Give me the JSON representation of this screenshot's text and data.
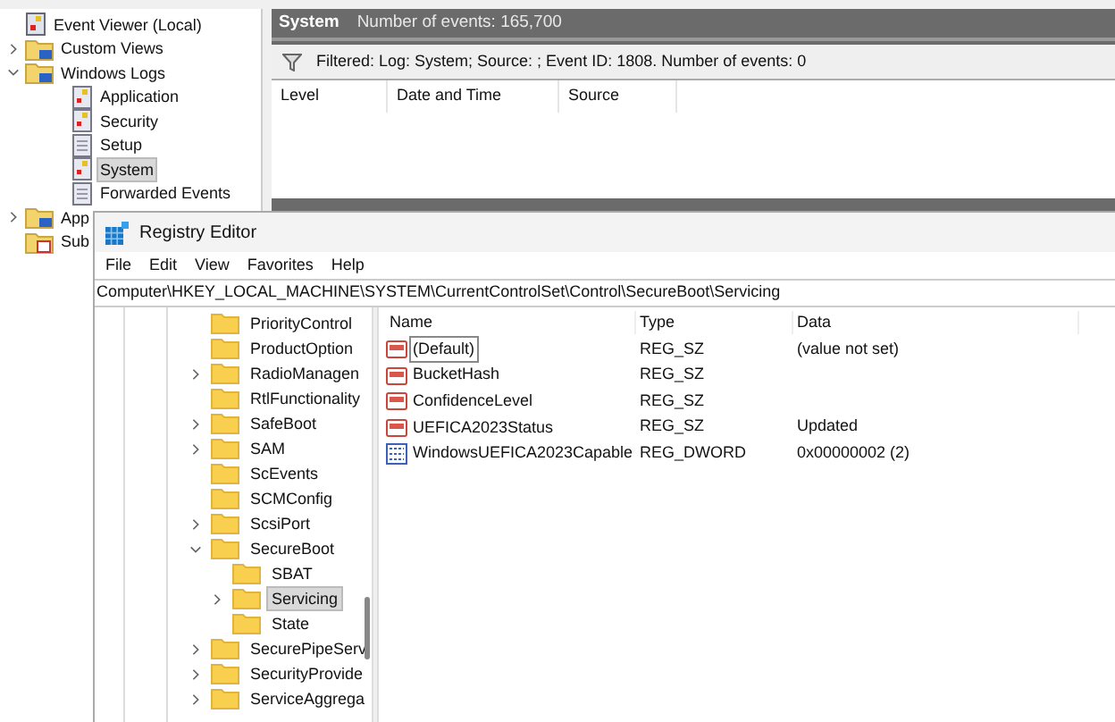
{
  "event_viewer": {
    "tree": [
      {
        "label": "Event Viewer (Local)",
        "kind": "root",
        "has_children": false,
        "selected": false
      },
      {
        "label": "Custom Views",
        "kind": "folder",
        "has_children": true,
        "expanded": false,
        "selected": false
      },
      {
        "label": "Windows Logs",
        "kind": "folder",
        "has_children": true,
        "expanded": true,
        "selected": false,
        "children": [
          {
            "label": "Application",
            "kind": "log",
            "has_children": false,
            "selected": false
          },
          {
            "label": "Security",
            "kind": "log",
            "has_children": false,
            "selected": false
          },
          {
            "label": "Setup",
            "kind": "plainlog",
            "has_children": false,
            "selected": false
          },
          {
            "label": "System",
            "kind": "log",
            "has_children": false,
            "selected": true
          },
          {
            "label": "Forwarded Events",
            "kind": "plainlog",
            "has_children": false,
            "selected": false
          }
        ]
      },
      {
        "label": "App",
        "kind": "folder",
        "has_children": true,
        "expanded": false,
        "selected": false
      },
      {
        "label": "Sub",
        "kind": "subs",
        "has_children": false,
        "selected": false
      }
    ],
    "header": {
      "title": "System",
      "count": "Number of events: 165,700"
    },
    "filter": "Filtered: Log: System; Source: ; Event ID: 1808. Number of events: 0",
    "columns": [
      "Level",
      "Date and Time",
      "Source"
    ]
  },
  "registry": {
    "title": "Registry Editor",
    "menu": [
      "File",
      "Edit",
      "View",
      "Favorites",
      "Help"
    ],
    "address": "Computer\\HKEY_LOCAL_MACHINE\\SYSTEM\\CurrentControlSet\\Control\\SecureBoot\\Servicing",
    "tree": [
      {
        "label": "PriorityControl",
        "has_children": false,
        "selected": false
      },
      {
        "label": "ProductOption",
        "has_children": false,
        "selected": false
      },
      {
        "label": "RadioManagen",
        "has_children": true,
        "expanded": false,
        "selected": false
      },
      {
        "label": "RtlFunctionality",
        "has_children": false,
        "selected": false
      },
      {
        "label": "SafeBoot",
        "has_children": true,
        "expanded": false,
        "selected": false
      },
      {
        "label": "SAM",
        "has_children": true,
        "expanded": false,
        "selected": false
      },
      {
        "label": "ScEvents",
        "has_children": false,
        "selected": false
      },
      {
        "label": "SCMConfig",
        "has_children": false,
        "selected": false
      },
      {
        "label": "ScsiPort",
        "has_children": true,
        "expanded": false,
        "selected": false
      },
      {
        "label": "SecureBoot",
        "has_children": true,
        "expanded": true,
        "selected": false,
        "children": [
          {
            "label": "SBAT",
            "has_children": false,
            "selected": false
          },
          {
            "label": "Servicing",
            "has_children": true,
            "expanded": false,
            "selected": true
          },
          {
            "label": "State",
            "has_children": false,
            "selected": false
          }
        ]
      },
      {
        "label": "SecurePipeServ",
        "has_children": true,
        "expanded": false,
        "selected": false
      },
      {
        "label": "SecurityProvide",
        "has_children": true,
        "expanded": false,
        "selected": false
      },
      {
        "label": "ServiceAggrega",
        "has_children": true,
        "expanded": false,
        "selected": false
      }
    ],
    "columns": [
      "Name",
      "Type",
      "Data"
    ],
    "values": [
      {
        "name": "(Default)",
        "kind": "string",
        "type": "REG_SZ",
        "data": "(value not set)",
        "selected": true
      },
      {
        "name": "BucketHash",
        "kind": "string",
        "type": "REG_SZ",
        "selected": false
      },
      {
        "name": "ConfidenceLevel",
        "kind": "string",
        "type": "REG_SZ",
        "selected": false
      },
      {
        "name": "UEFICA2023Status",
        "kind": "string",
        "type": "REG_SZ",
        "data": "Updated",
        "selected": false
      },
      {
        "name": "WindowsUEFICA2023Capable",
        "kind": "binary",
        "type": "REG_DWORD",
        "data": "0x00000002 (2)",
        "selected": false
      }
    ]
  }
}
